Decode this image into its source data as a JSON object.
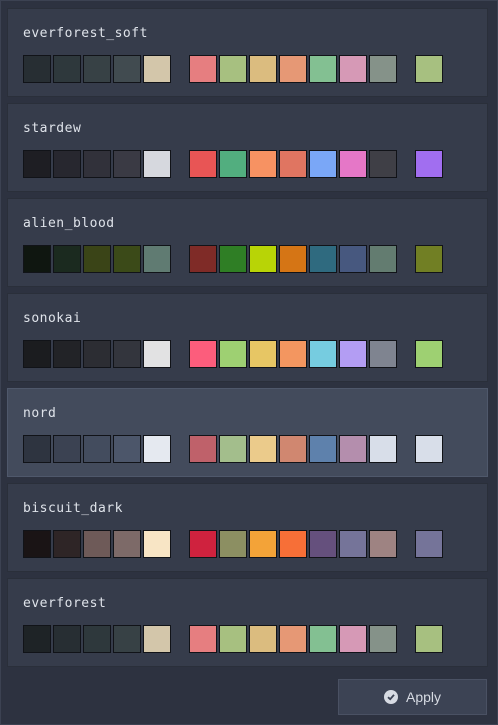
{
  "themes": [
    {
      "name": "everforest_soft",
      "selected": false,
      "bg": [
        "#272e33",
        "#2e383c",
        "#374145",
        "#414b50",
        "#d3c6aa"
      ],
      "fg": [
        "#e67e80",
        "#a7c080",
        "#dbbc7f",
        "#e69875",
        "#83c092",
        "#d699b6",
        "#859289"
      ],
      "accent": "#a7c080"
    },
    {
      "name": "stardew",
      "selected": false,
      "bg": [
        "#1e1e23",
        "#27272f",
        "#31313a",
        "#3a3a44",
        "#d6d8de"
      ],
      "fg": [
        "#e85555",
        "#52ae7f",
        "#f79262",
        "#e07561",
        "#7aa7f7",
        "#e577c7",
        "#3f3f46"
      ],
      "accent": "#a16ef0"
    },
    {
      "name": "alien_blood",
      "selected": false,
      "bg": [
        "#0f1610",
        "#1b2a1f",
        "#3a4417",
        "#3b4a18",
        "#607b72"
      ],
      "fg": [
        "#7f2b27",
        "#2f7e25",
        "#b8d406",
        "#d57515",
        "#2f6a7f",
        "#47587f",
        "#637c70"
      ],
      "accent": "#717f24"
    },
    {
      "name": "sonokai",
      "selected": false,
      "bg": [
        "#1b1c1f",
        "#222327",
        "#2c2d33",
        "#33353d",
        "#e2e2e3"
      ],
      "fg": [
        "#fc5d7c",
        "#9ed072",
        "#e7c664",
        "#f39660",
        "#76cce0",
        "#b39df3",
        "#7f8490"
      ],
      "accent": "#9ed072"
    },
    {
      "name": "nord",
      "selected": true,
      "bg": [
        "#2e3440",
        "#3b4252",
        "#434c5e",
        "#4c566a",
        "#e5e9f0"
      ],
      "fg": [
        "#bf616a",
        "#a3be8c",
        "#ebcb8b",
        "#d08770",
        "#5e81ac",
        "#b48ead",
        "#d8dee9"
      ],
      "accent": "#d8dee9"
    },
    {
      "name": "biscuit_dark",
      "selected": false,
      "bg": [
        "#1a1415",
        "#2e2526",
        "#6e5a58",
        "#7d6a68",
        "#f8e5c5"
      ],
      "fg": [
        "#cf223e",
        "#8c8f62",
        "#f3a338",
        "#f76f37",
        "#65507d",
        "#757499",
        "#9e8382"
      ],
      "accent": "#757499"
    },
    {
      "name": "everforest",
      "selected": false,
      "bg": [
        "#1e2326",
        "#272e33",
        "#2e383c",
        "#374145",
        "#d3c6aa"
      ],
      "fg": [
        "#e67e80",
        "#a7c080",
        "#dbbc7f",
        "#e69875",
        "#83c092",
        "#d699b6",
        "#859289"
      ],
      "accent": "#a7c080"
    }
  ],
  "footer": {
    "apply_label": "Apply",
    "apply_icon": "check-circle-icon"
  }
}
